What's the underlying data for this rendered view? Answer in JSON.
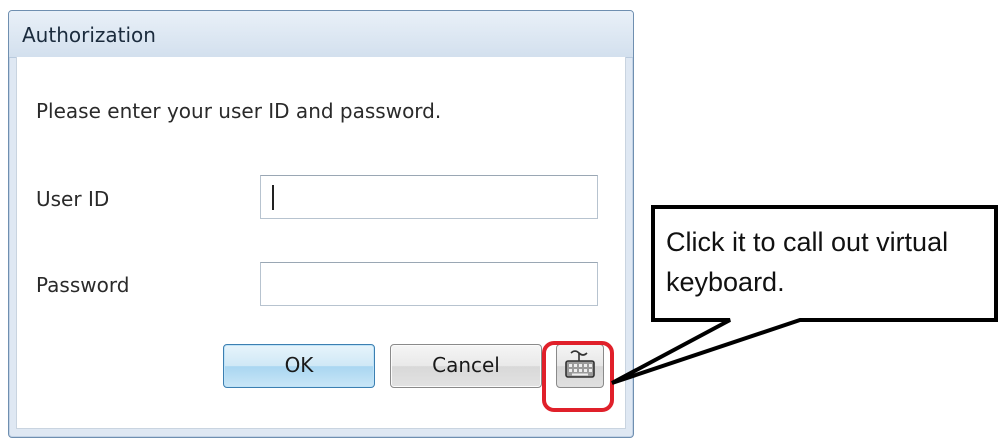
{
  "dialog": {
    "title": "Authorization",
    "prompt": "Please enter your user ID and password.",
    "user_id_label": "User ID",
    "user_id_value": "",
    "password_label": "Password",
    "password_value": "",
    "ok_label": "OK",
    "cancel_label": "Cancel",
    "keyboard_icon": "virtual-keyboard-icon"
  },
  "annotation": {
    "callout_text": "Click it to call out virtual keyboard.",
    "highlight_color": "#e0202a"
  },
  "colors": {
    "ok_accent": "#3c7fb1",
    "titlebar": "#d3e0ee"
  }
}
